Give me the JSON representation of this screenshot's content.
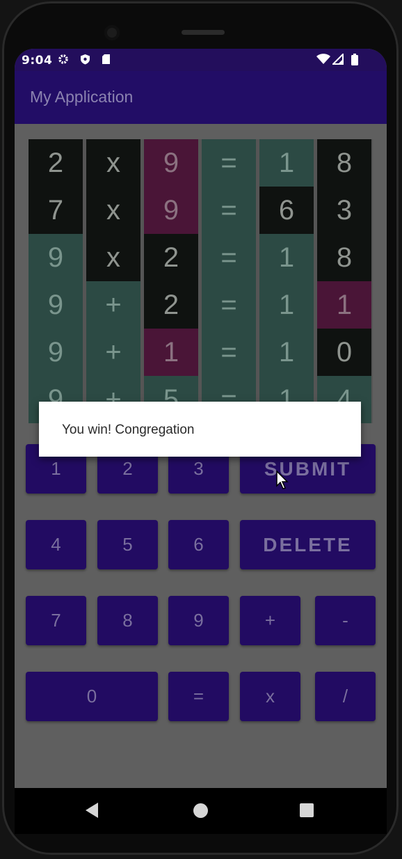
{
  "status_bar": {
    "time": "9:04",
    "icons": [
      "settings-icon",
      "shield-icon",
      "sd-card-icon",
      "wifi-icon",
      "signal-icon",
      "battery-icon"
    ]
  },
  "app_bar": {
    "title": "My Application"
  },
  "board": {
    "columns": [
      {
        "cells": [
          {
            "text": "2",
            "tone": "dark"
          },
          {
            "text": "7",
            "tone": "dark"
          },
          {
            "text": "9",
            "tone": "teal"
          },
          {
            "text": "9",
            "tone": "teal"
          },
          {
            "text": "9",
            "tone": "teal"
          },
          {
            "text": "9",
            "tone": "teal"
          }
        ]
      },
      {
        "cells": [
          {
            "text": "x",
            "tone": "dark"
          },
          {
            "text": "x",
            "tone": "dark"
          },
          {
            "text": "x",
            "tone": "dark"
          },
          {
            "text": "+",
            "tone": "teal"
          },
          {
            "text": "+",
            "tone": "teal"
          },
          {
            "text": "+",
            "tone": "teal"
          }
        ]
      },
      {
        "cells": [
          {
            "text": "9",
            "tone": "plum"
          },
          {
            "text": "9",
            "tone": "plum"
          },
          {
            "text": "2",
            "tone": "dark"
          },
          {
            "text": "2",
            "tone": "dark"
          },
          {
            "text": "1",
            "tone": "plum"
          },
          {
            "text": "5",
            "tone": "teal"
          }
        ]
      },
      {
        "cells": [
          {
            "text": "=",
            "tone": "teal"
          },
          {
            "text": "=",
            "tone": "teal"
          },
          {
            "text": "=",
            "tone": "teal"
          },
          {
            "text": "=",
            "tone": "teal"
          },
          {
            "text": "=",
            "tone": "teal"
          },
          {
            "text": "=",
            "tone": "teal"
          }
        ]
      },
      {
        "cells": [
          {
            "text": "1",
            "tone": "teal"
          },
          {
            "text": "6",
            "tone": "dark"
          },
          {
            "text": "1",
            "tone": "teal"
          },
          {
            "text": "1",
            "tone": "teal"
          },
          {
            "text": "1",
            "tone": "teal"
          },
          {
            "text": "1",
            "tone": "teal"
          }
        ]
      },
      {
        "cells": [
          {
            "text": "8",
            "tone": "dark"
          },
          {
            "text": "3",
            "tone": "dark"
          },
          {
            "text": "8",
            "tone": "dark"
          },
          {
            "text": "1",
            "tone": "plum"
          },
          {
            "text": "0",
            "tone": "dark"
          },
          {
            "text": "4",
            "tone": "teal"
          }
        ]
      }
    ]
  },
  "keypad": {
    "key_1": "1",
    "key_2": "2",
    "key_3": "3",
    "submit": "SUBMIT",
    "key_4": "4",
    "key_5": "5",
    "key_6": "6",
    "delete": "DELETE",
    "key_7": "7",
    "key_8": "8",
    "key_9": "9",
    "plus": "+",
    "minus": "-",
    "key_0": "0",
    "equals": "=",
    "multiply": "x",
    "divide": "/"
  },
  "dialog": {
    "message": "You win! Congregation"
  },
  "nav_bar": {
    "icons": [
      "back-icon",
      "home-icon",
      "recents-icon"
    ]
  },
  "colors": {
    "app_bar": "#220d66",
    "status_bar": "#230e5c",
    "button": "#220b62",
    "cell_dark": "#0f1210",
    "cell_teal": "#2c4a44",
    "cell_plum": "#4a1537"
  }
}
